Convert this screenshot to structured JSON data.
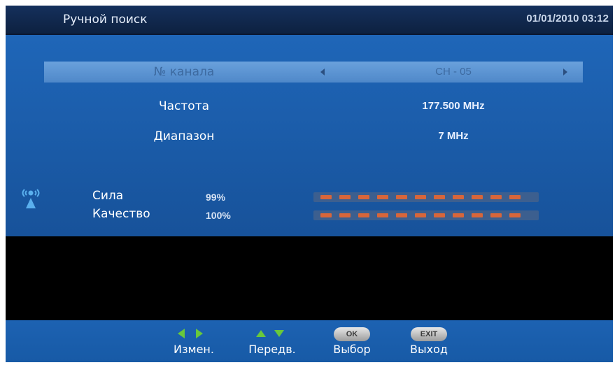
{
  "header": {
    "title": "Ручной поиск",
    "datetime": "01/01/2010 03:12"
  },
  "settings": {
    "rows": [
      {
        "label": "№ канала",
        "value": "CH - 05",
        "selected": true
      },
      {
        "label": "Частота",
        "value": "177.500 MHz"
      },
      {
        "label": "Диапазон",
        "value": "7 MHz"
      }
    ]
  },
  "signal": {
    "icon": "antenna-signal-icon",
    "strength": {
      "label": "Сила",
      "percent_text": "99%",
      "level": 99
    },
    "quality": {
      "label": "Качество",
      "percent_text": "100%",
      "level": 100
    },
    "segments_total": 11
  },
  "footer": {
    "hints": [
      {
        "icon": "left-right-arrows-icon",
        "label": "Измен."
      },
      {
        "icon": "up-down-arrows-icon",
        "label": "Передв."
      },
      {
        "icon": "ok-button-icon",
        "key": "OK",
        "label": "Выбор"
      },
      {
        "icon": "exit-button-icon",
        "key": "EXIT",
        "label": "Выход"
      }
    ]
  },
  "colors": {
    "background": "#1a5aa6",
    "header": "#0d2140",
    "selection": "#4f88c9",
    "meter_segment": "#d8663a",
    "hint_arrow": "#68c83c"
  }
}
